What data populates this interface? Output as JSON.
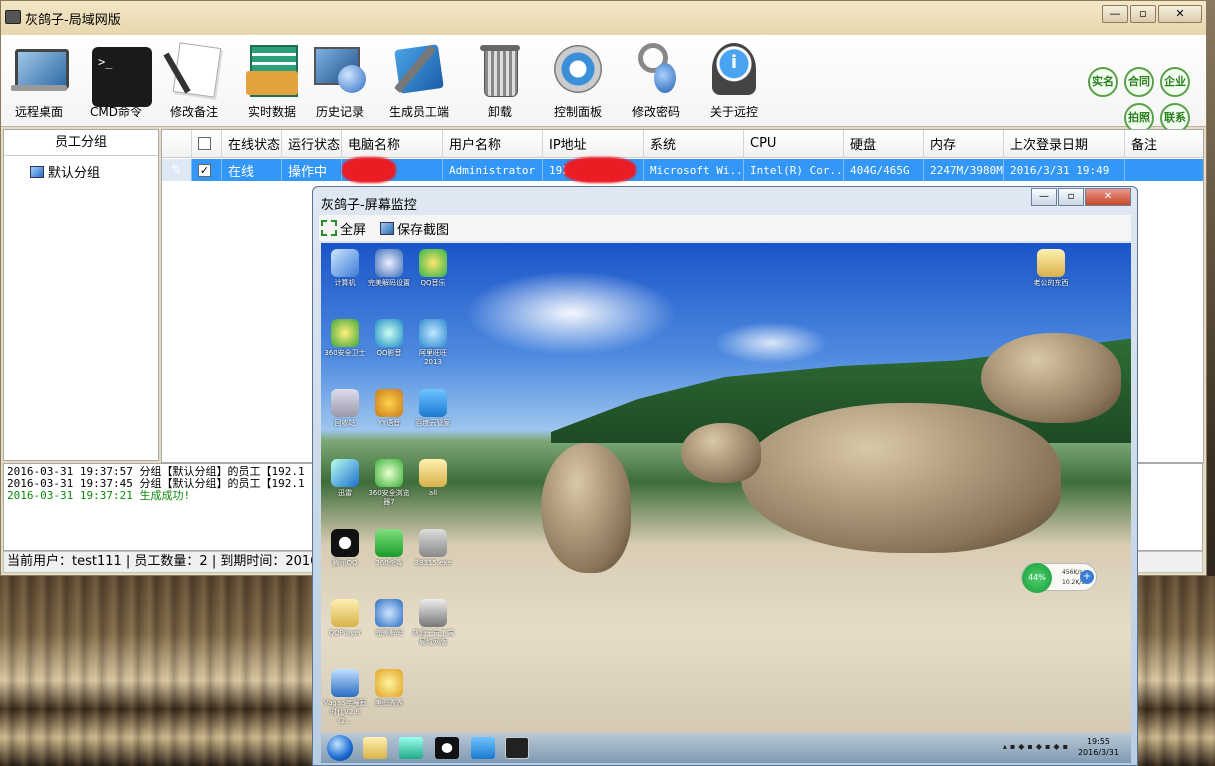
{
  "app": {
    "title": "灰鸽子-局域网版"
  },
  "toolbar": [
    {
      "label": "远程桌面",
      "icon": "monitor-icon"
    },
    {
      "label": "CMD命令",
      "icon": "cmd-icon"
    },
    {
      "label": "修改备注",
      "icon": "note-icon"
    },
    {
      "label": "实时数据",
      "icon": "data-icon"
    },
    {
      "label": "历史记录",
      "icon": "history-icon"
    },
    {
      "label": "生成员工端",
      "icon": "build-icon"
    },
    {
      "label": "卸载",
      "icon": "trash-icon"
    },
    {
      "label": "控制面板",
      "icon": "control-panel-icon"
    },
    {
      "label": "修改密码",
      "icon": "key-icon"
    },
    {
      "label": "关于远控",
      "icon": "info-icon"
    }
  ],
  "round_buttons": [
    "实名",
    "合同",
    "企业",
    "拍照",
    "联系"
  ],
  "left_panel": {
    "header": "员工分组",
    "groups": [
      "默认分组"
    ]
  },
  "grid": {
    "columns": [
      "在线状态",
      "运行状态",
      "电脑名称",
      "用户名称",
      "IP地址",
      "系统",
      "CPU",
      "硬盘",
      "内存",
      "上次登录日期",
      "备注"
    ],
    "rows": [
      {
        "online": "在线",
        "running": "操作中",
        "pc": "",
        "user": "Administrator",
        "ip": "192.",
        "os": "Microsoft Wi...",
        "cpu": "Intel(R) Cor...",
        "disk": "404G/465G",
        "mem": "2247M/3980M",
        "last_login": "2016/3/31 19:49",
        "note": ""
      }
    ]
  },
  "log": [
    {
      "text": "2016-03-31  19:37:57 分组【默认分组】的员工【192.1",
      "color": "#000000"
    },
    {
      "text": "2016-03-31  19:37:45 分组【默认分组】的员工【192.1",
      "color": "#000000"
    },
    {
      "text": "2016-03-31  19:37:21 生成成功!",
      "color": "#0a8a0a"
    }
  ],
  "status": "当前用户：test111 | 员工数量：2 | 到期时间：2016-09-3",
  "monitor": {
    "title": "灰鸽子-屏幕监控",
    "fullscreen": "全屏",
    "save_screenshot": "保存截图",
    "desktop_icons": [
      {
        "label": "计算机"
      },
      {
        "label": "完美解码设置"
      },
      {
        "label": "QQ音乐"
      },
      {
        "label": "360安全卫士"
      },
      {
        "label": "QQ影音"
      },
      {
        "label": "阿里旺旺2013"
      },
      {
        "label": "回收站"
      },
      {
        "label": "YY语音"
      },
      {
        "label": "百度云管家"
      },
      {
        "label": "迅雷"
      },
      {
        "label": "360安全浏览器7"
      },
      {
        "label": "all"
      },
      {
        "label": "腾讯QQ"
      },
      {
        "label": "360杀毒"
      },
      {
        "label": "38315.exe"
      },
      {
        "label": "QQPlayer"
      },
      {
        "label": "完美解码"
      },
      {
        "label": "灰鸽子员工端局域网版"
      },
      {
        "label": "Vagaa哇嘎画时代V2.6 (2..."
      },
      {
        "label": "美图秀秀"
      }
    ],
    "top_right_folder": "老公的东西",
    "net_widget": {
      "percent": "44%",
      "up": "456K/s",
      "down": "10.2K/s"
    },
    "clock": {
      "time": "19:55",
      "date": "2016/3/31"
    }
  }
}
